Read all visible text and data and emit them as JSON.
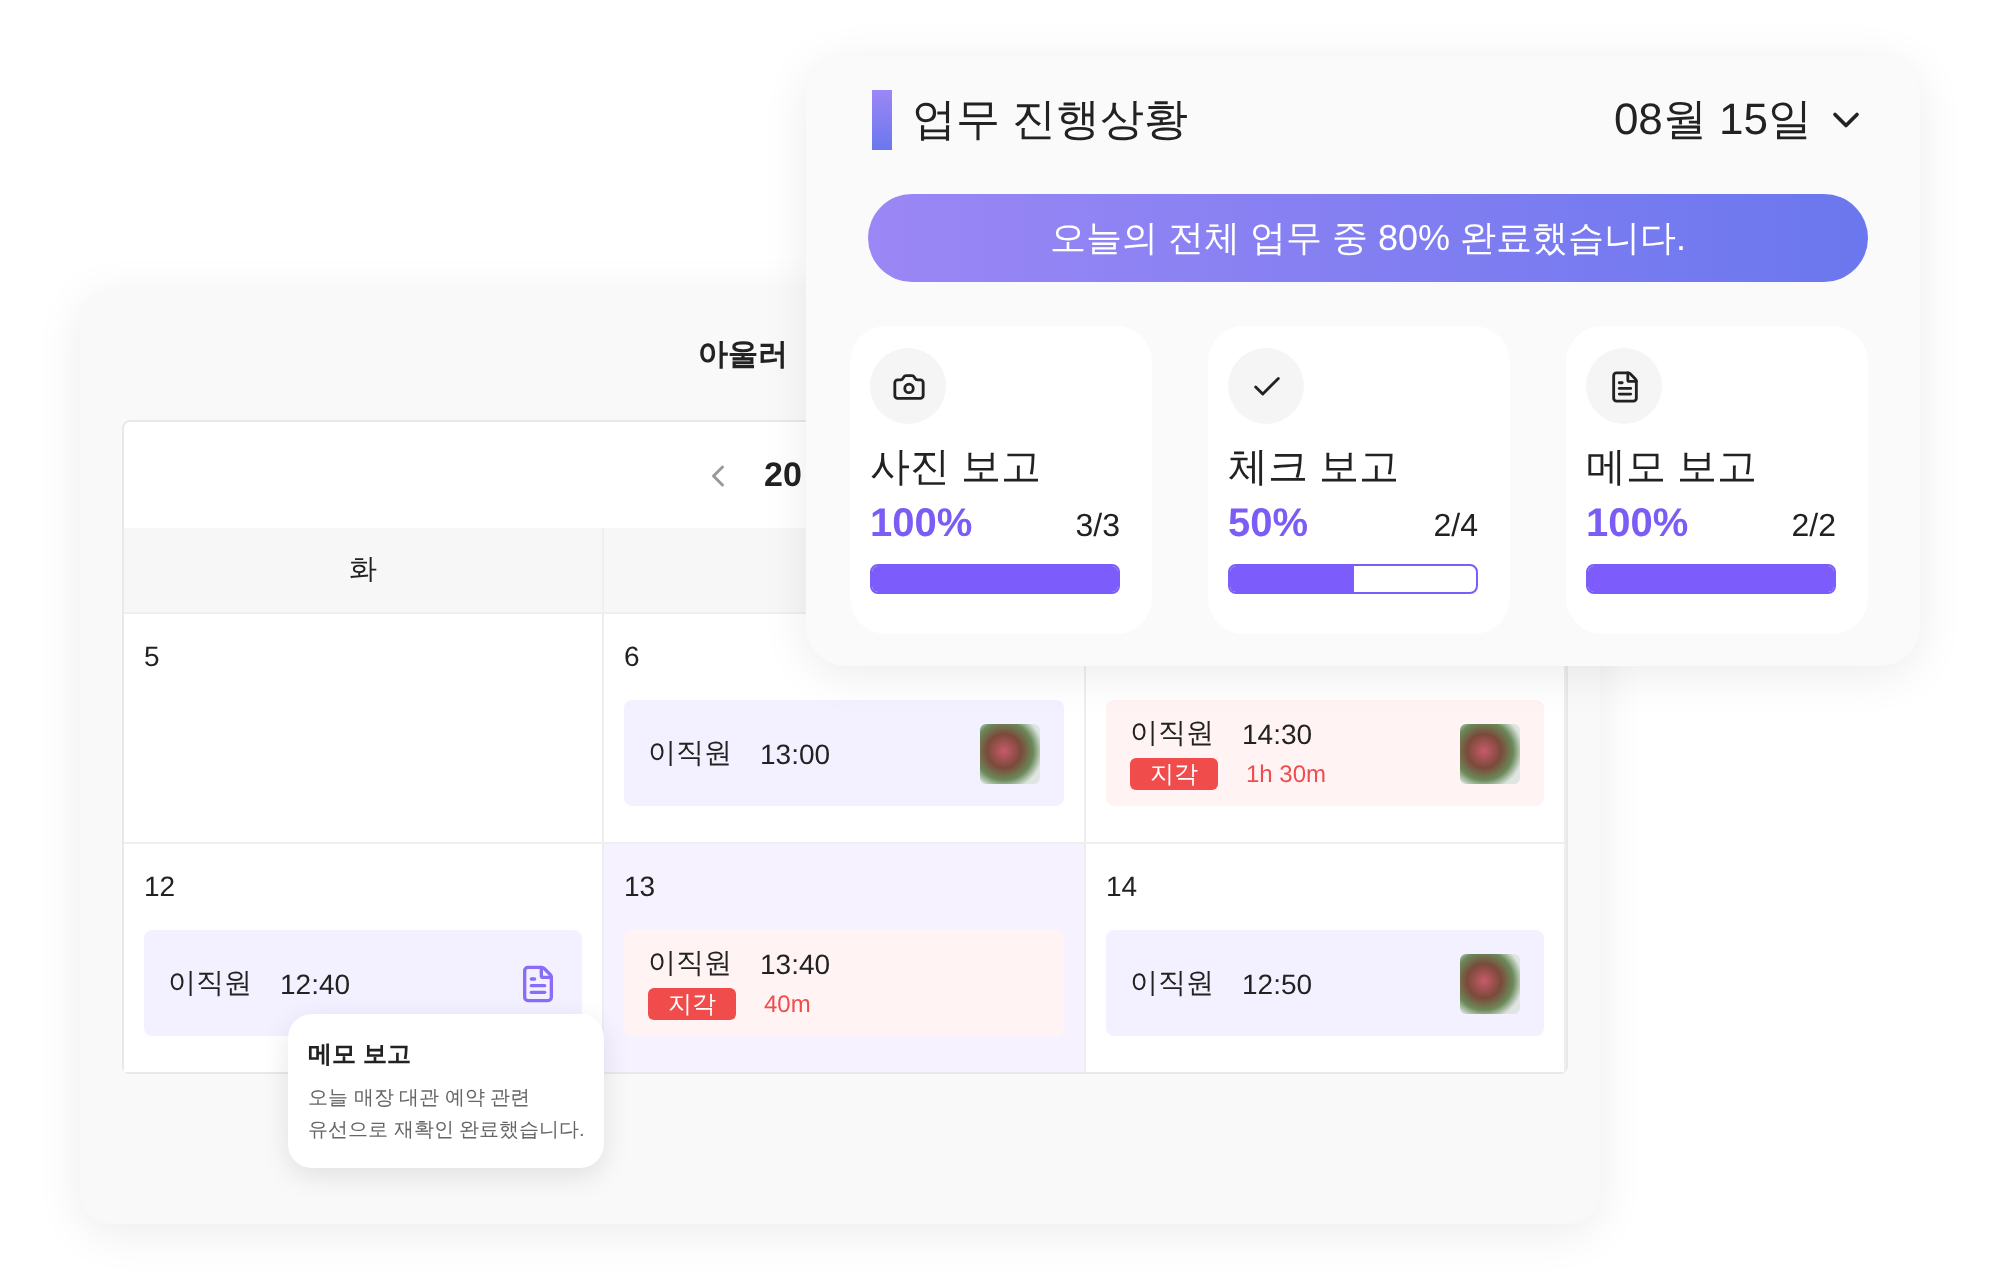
{
  "calendar": {
    "title": "아울러",
    "month": "20",
    "columns": [
      {
        "label": "화"
      }
    ],
    "weeks": [
      {
        "days": [
          {
            "date": "5",
            "selected": false
          },
          {
            "date": "6",
            "selected": false,
            "events": [
              {
                "kind": "plain",
                "name": "이직원",
                "time": "13:00",
                "photo": true
              }
            ]
          },
          {
            "selected": false,
            "events": [
              {
                "kind": "late",
                "name": "이직원",
                "time": "14:30",
                "badge": "지각",
                "late_by": "1h 30m",
                "photo": true
              }
            ]
          }
        ]
      },
      {
        "days": [
          {
            "date": "12",
            "selected": false,
            "events": [
              {
                "kind": "plain",
                "name": "이직원",
                "time": "12:40",
                "memo": true,
                "tooltip": {
                  "title": "메모 보고",
                  "text": "오늘 매장 대관 예약 관련\n유선으로 재확인 완료했습니다."
                }
              }
            ]
          },
          {
            "date": "13",
            "selected": true,
            "events": [
              {
                "kind": "late",
                "name": "이직원",
                "time": "13:40",
                "badge": "지각",
                "late_by": "40m"
              }
            ]
          },
          {
            "date": "14",
            "selected": false,
            "events": [
              {
                "kind": "plain",
                "name": "이직원",
                "time": "12:50",
                "photo": true
              }
            ]
          }
        ]
      }
    ]
  },
  "progress": {
    "title": "업무 진행상황",
    "date": "08월 15일",
    "summary": "오늘의 전체 업무 중 80% 완료했습니다.",
    "reports": [
      {
        "kind": "photo",
        "title": "사진 보고",
        "percent": "100%",
        "count": "3/3",
        "level": 1
      },
      {
        "kind": "check",
        "title": "체크 보고",
        "percent": "50%",
        "count": "2/4",
        "level": 0.5
      },
      {
        "kind": "memo",
        "title": "메모 보고",
        "percent": "100%",
        "count": "2/2",
        "level": 1
      }
    ]
  }
}
